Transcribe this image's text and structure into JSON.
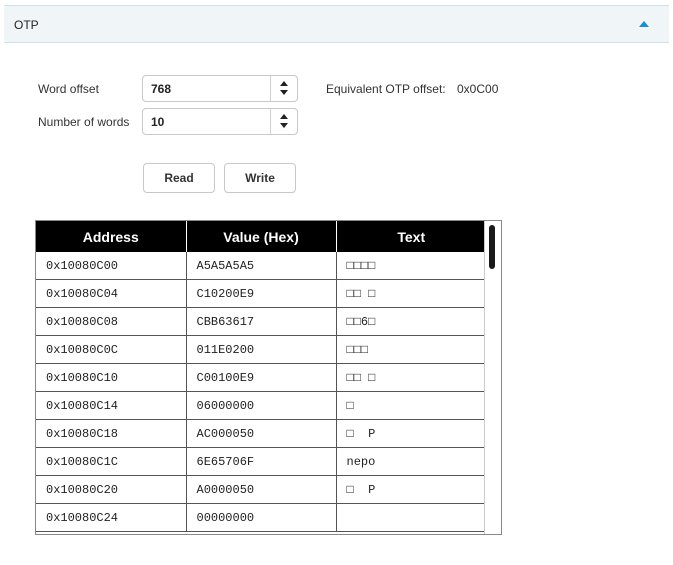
{
  "panel": {
    "title": "OTP"
  },
  "form": {
    "word_offset_label": "Word offset",
    "word_offset_value": "768",
    "num_words_label": "Number of words",
    "num_words_value": "10",
    "equiv_label": "Equivalent OTP offset:",
    "equiv_value": "0x0C00"
  },
  "buttons": {
    "read": "Read",
    "write": "Write"
  },
  "table": {
    "headers": [
      "Address",
      "Value (Hex)",
      "Text"
    ],
    "rows": [
      {
        "address": "0x10080C00",
        "value": "A5A5A5A5",
        "text": "□□□□"
      },
      {
        "address": "0x10080C04",
        "value": "C10200E9",
        "text": "□□ □"
      },
      {
        "address": "0x10080C08",
        "value": "CBB63617",
        "text": "□□6□"
      },
      {
        "address": "0x10080C0C",
        "value": "011E0200",
        "text": "□□□"
      },
      {
        "address": "0x10080C10",
        "value": "C00100E9",
        "text": "□□ □"
      },
      {
        "address": "0x10080C14",
        "value": "06000000",
        "text": "□"
      },
      {
        "address": "0x10080C18",
        "value": "AC000050",
        "text": "□  P"
      },
      {
        "address": "0x10080C1C",
        "value": "6E65706F",
        "text": "nepo"
      },
      {
        "address": "0x10080C20",
        "value": "A0000050",
        "text": "□  P"
      },
      {
        "address": "0x10080C24",
        "value": "00000000",
        "text": ""
      }
    ]
  },
  "colors": {
    "accent": "#1a8fd6",
    "header_bg": "#f0f5f8",
    "table_header_bg": "#000000"
  },
  "icons": {
    "collapse": "chevron-up-icon",
    "spin_up": "spin-up-icon",
    "spin_down": "spin-down-icon"
  }
}
